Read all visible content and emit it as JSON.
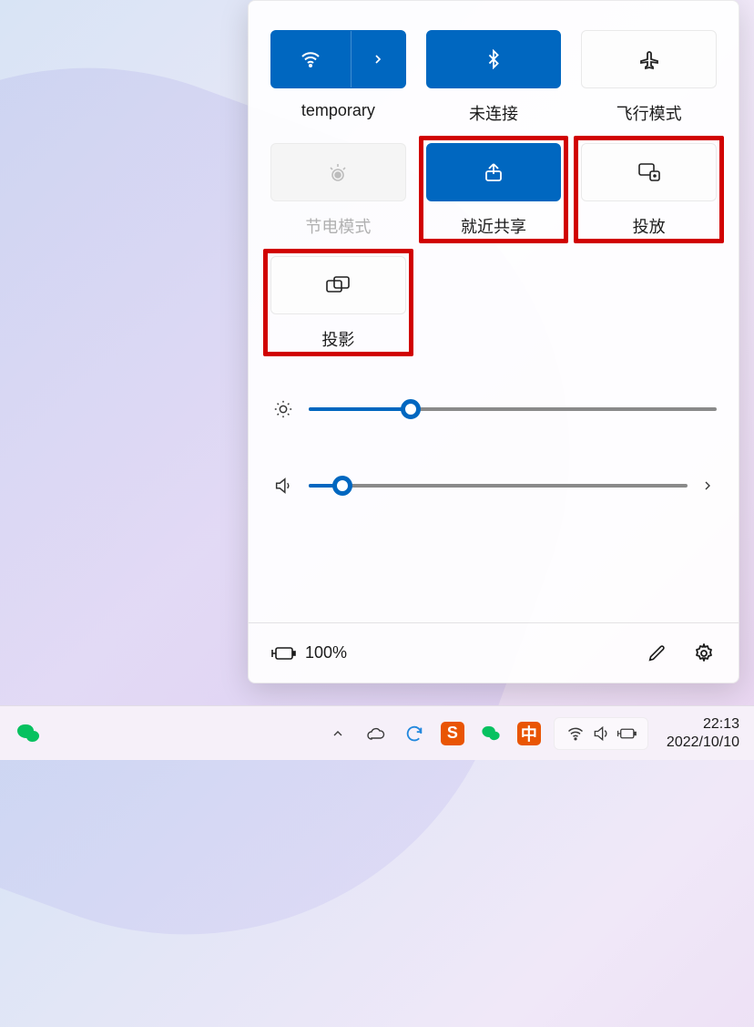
{
  "tiles": [
    {
      "label": "temporary",
      "state": "on",
      "icon": "wifi-icon",
      "split": true
    },
    {
      "label": "未连接",
      "state": "on",
      "icon": "bluetooth-icon"
    },
    {
      "label": "飞行模式",
      "state": "off",
      "icon": "airplane-icon"
    },
    {
      "label": "节电模式",
      "state": "disabled",
      "icon": "battery-saver-icon"
    },
    {
      "label": "就近共享",
      "state": "on",
      "icon": "share-icon",
      "highlight": true
    },
    {
      "label": "投放",
      "state": "off",
      "icon": "cast-icon",
      "highlight": true
    },
    {
      "label": "投影",
      "state": "off",
      "icon": "project-icon",
      "highlight": true
    }
  ],
  "sliders": {
    "brightness_percent": 25,
    "volume_percent": 9
  },
  "footer": {
    "battery_text": "100%"
  },
  "taskbar": {
    "time": "22:13",
    "date": "2022/10/10",
    "sogou_glyph": "S",
    "sogou_glyph2": "中"
  }
}
